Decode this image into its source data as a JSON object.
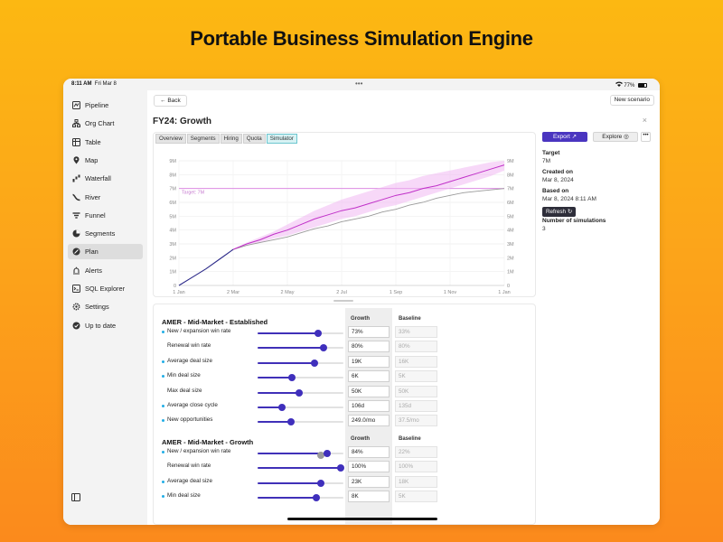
{
  "headline": "Portable Business Simulation Engine",
  "status": {
    "time": "8:11 AM",
    "date": "Fri Mar 8",
    "battery": "77%"
  },
  "sidebar": {
    "items": [
      {
        "label": "Pipeline",
        "icon": "pipeline-icon"
      },
      {
        "label": "Org Chart",
        "icon": "org-chart-icon"
      },
      {
        "label": "Table",
        "icon": "table-icon"
      },
      {
        "label": "Map",
        "icon": "map-icon"
      },
      {
        "label": "Waterfall",
        "icon": "waterfall-icon"
      },
      {
        "label": "River",
        "icon": "river-icon"
      },
      {
        "label": "Funnel",
        "icon": "funnel-icon"
      },
      {
        "label": "Segments",
        "icon": "segments-icon"
      },
      {
        "label": "Plan",
        "icon": "plan-icon",
        "active": true
      },
      {
        "label": "Alerts",
        "icon": "alerts-icon"
      },
      {
        "label": "SQL Explorer",
        "icon": "sql-icon"
      },
      {
        "label": "Settings",
        "icon": "gear-icon"
      },
      {
        "label": "Up to date",
        "icon": "check-circle-icon"
      }
    ]
  },
  "toolbar": {
    "back_label": "Back",
    "new_scenario_label": "New scenario",
    "close_label": "×"
  },
  "page_title": "FY24: Growth",
  "tabs": [
    {
      "label": "Overview"
    },
    {
      "label": "Segments"
    },
    {
      "label": "Hiring"
    },
    {
      "label": "Quota"
    },
    {
      "label": "Simulator",
      "active": true
    }
  ],
  "panel": {
    "export_label": "Export",
    "explore_label": "Explore",
    "more_label": "•••",
    "target_label": "Target",
    "target_value": "7M",
    "created_label": "Created on",
    "created_value": "Mar 8, 2024",
    "based_label": "Based on",
    "based_value": "Mar 8, 2024 8:11 AM",
    "refresh_label": "Refresh",
    "sims_label": "Number of simulations",
    "sims_value": "3"
  },
  "chart_data": {
    "type": "line",
    "x_tick_labels": [
      "1 Jan",
      "2 Mar",
      "2 May",
      "2 Jul",
      "1 Sep",
      "1 Nov",
      "1 Jan"
    ],
    "y_tick_labels": [
      "0",
      "1M",
      "2M",
      "3M",
      "4M",
      "5M",
      "6M",
      "7M",
      "8M",
      "9M"
    ],
    "ylim": [
      0,
      9
    ],
    "target": {
      "value": 7,
      "label": "Target: 7M"
    },
    "x": [
      0,
      0.5,
      1,
      1.5,
      2,
      2.5,
      3,
      3.5,
      4,
      4.5,
      5,
      5.5,
      6,
      6.5,
      7,
      7.5,
      8,
      8.5,
      9,
      9.5,
      10,
      10.5,
      11,
      11.5,
      12
    ],
    "series": [
      {
        "name": "Growth",
        "color": "#c030c8",
        "values": [
          0,
          0.6,
          1.2,
          1.9,
          2.6,
          3.0,
          3.3,
          3.7,
          4.0,
          4.4,
          4.8,
          5.1,
          5.4,
          5.6,
          5.9,
          6.2,
          6.5,
          6.7,
          7.0,
          7.2,
          7.5,
          7.8,
          8.1,
          8.4,
          8.7
        ],
        "band_low": [
          0,
          0.6,
          1.2,
          1.9,
          2.6,
          2.9,
          3.1,
          3.4,
          3.6,
          3.9,
          4.2,
          4.5,
          4.8,
          5.0,
          5.3,
          5.6,
          5.8,
          6.1,
          6.4,
          6.7,
          7.0,
          7.3,
          7.6,
          7.9,
          8.3
        ],
        "band_high": [
          0,
          0.6,
          1.2,
          1.9,
          2.6,
          3.1,
          3.5,
          3.9,
          4.4,
          4.9,
          5.4,
          5.8,
          6.2,
          6.5,
          6.8,
          7.1,
          7.4,
          7.6,
          7.9,
          8.1,
          8.3,
          8.5,
          8.7,
          8.9,
          9.0
        ]
      },
      {
        "name": "Baseline",
        "color": "#9a9a9a",
        "values": [
          0,
          0.6,
          1.2,
          1.9,
          2.6,
          2.9,
          3.1,
          3.3,
          3.5,
          3.8,
          4.1,
          4.3,
          4.6,
          4.8,
          5.0,
          5.3,
          5.5,
          5.8,
          6.0,
          6.3,
          6.5,
          6.7,
          6.8,
          6.9,
          7.0
        ]
      }
    ],
    "actual_until_x": 2,
    "actual_color": "#2d2b8a",
    "grid": true,
    "legend": "bottom-left"
  },
  "params": {
    "growth_header": "Growth",
    "baseline_header": "Baseline",
    "sections": [
      {
        "title": "AMER - Mid-Market - Established",
        "rows": [
          {
            "label": "New / expansion win rate",
            "dot": true,
            "pos": 0.7,
            "growth": "73%",
            "baseline": "33%"
          },
          {
            "label": "Renewal win rate",
            "dot": false,
            "pos": 0.77,
            "growth": "80%",
            "baseline": "80%"
          },
          {
            "label": "Average deal size",
            "dot": true,
            "pos": 0.66,
            "growth": "19K",
            "baseline": "16K"
          },
          {
            "label": "Min deal size",
            "dot": true,
            "pos": 0.4,
            "growth": "6K",
            "baseline": "5K"
          },
          {
            "label": "Max deal size",
            "dot": false,
            "pos": 0.48,
            "growth": "50K",
            "baseline": "50K"
          },
          {
            "label": "Average close cycle",
            "dot": true,
            "pos": 0.28,
            "growth": "106d",
            "baseline": "135d"
          },
          {
            "label": "New opportunities",
            "dot": true,
            "pos": 0.39,
            "growth": "249.0/mo",
            "baseline": "37.5/mo"
          }
        ]
      },
      {
        "title": "AMER - Mid-Market - Growth",
        "rows": [
          {
            "label": "New / expansion win rate",
            "dot": true,
            "pos": 0.81,
            "ghost": 0.74,
            "growth": "84%",
            "baseline": "22%"
          },
          {
            "label": "Renewal win rate",
            "dot": false,
            "pos": 0.97,
            "growth": "100%",
            "baseline": "100%"
          },
          {
            "label": "Average deal size",
            "dot": true,
            "pos": 0.74,
            "growth": "23K",
            "baseline": "18K"
          },
          {
            "label": "Min deal size",
            "dot": true,
            "pos": 0.68,
            "growth": "8K",
            "baseline": "5K"
          }
        ]
      }
    ]
  }
}
